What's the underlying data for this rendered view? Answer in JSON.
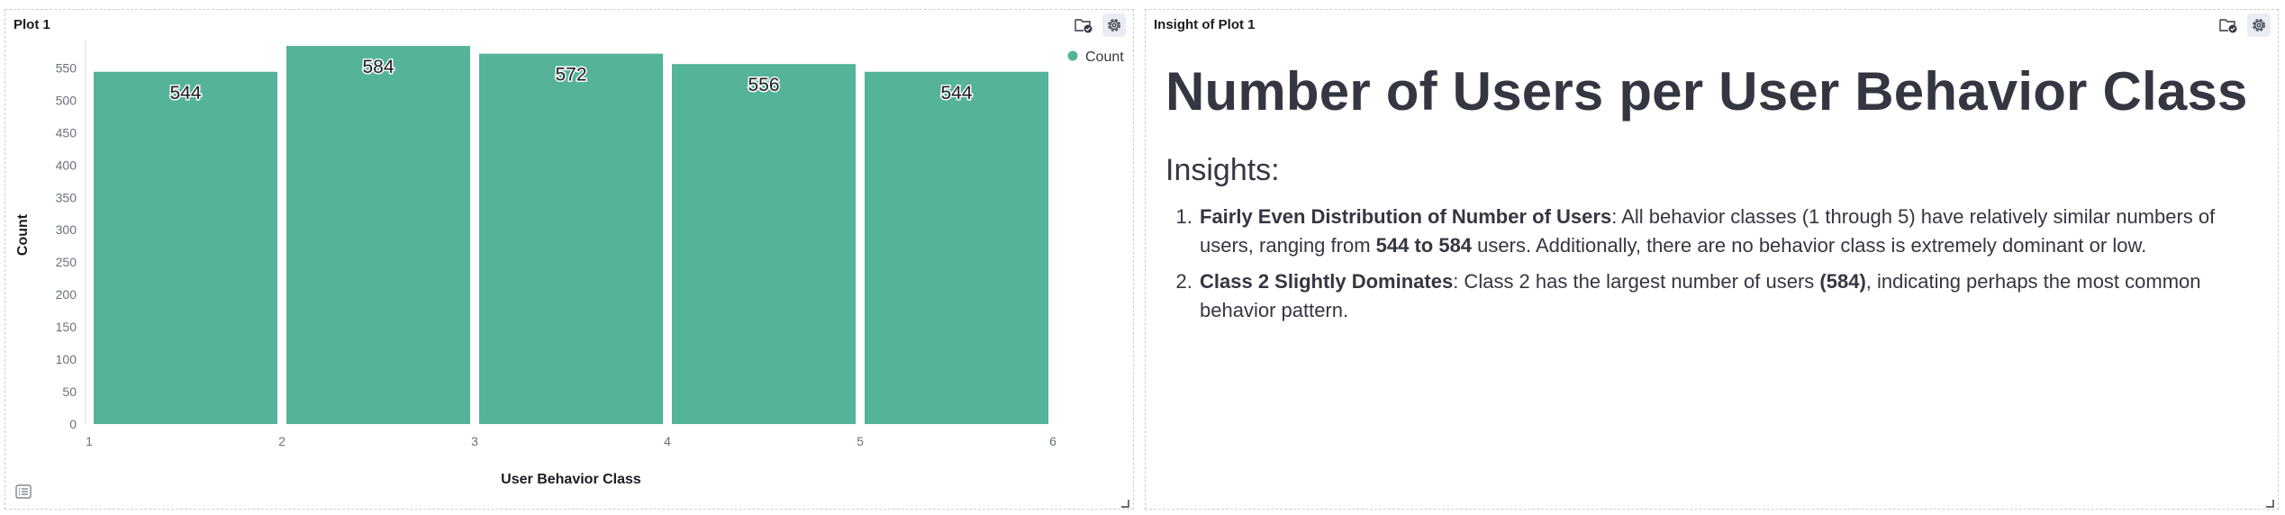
{
  "plot_panel": {
    "title": "Plot 1",
    "icons": [
      "folder-check-icon",
      "gear-icon",
      "list-icon",
      "resize-icon"
    ]
  },
  "insight_panel": {
    "title": "Insight of Plot 1",
    "heading": "Number of Users per User Behavior Class",
    "subheading": "Insights:",
    "items": [
      {
        "lead": "Fairly Even Distribution of Number of Users",
        "text_1": ": All behavior classes (1 through 5) have relatively similar numbers of users, ranging from ",
        "bold_1": "544 to 584",
        "text_2": " users. Additionally, there are no behavior class is extremely dominant or low."
      },
      {
        "lead": "Class 2 Slightly Dominates",
        "text_1": ": Class 2 has the largest number of users ",
        "bold_1": "(584)",
        "text_2": ", indicating perhaps the most common behavior pattern."
      }
    ]
  },
  "chart_data": {
    "type": "bar",
    "bins": [
      [
        1,
        2
      ],
      [
        2,
        3
      ],
      [
        3,
        4
      ],
      [
        4,
        5
      ],
      [
        5,
        6
      ]
    ],
    "values": [
      544,
      584,
      572,
      556,
      544
    ],
    "data_labels": [
      "544",
      "584",
      "572",
      "556",
      "544"
    ],
    "xticks": [
      "1",
      "2",
      "3",
      "4",
      "5",
      "6"
    ],
    "yticks": [
      "0",
      "50",
      "100",
      "150",
      "200",
      "250",
      "300",
      "350",
      "400",
      "450",
      "500",
      "550"
    ],
    "xlim": [
      1,
      6
    ],
    "ylim": [
      0,
      584
    ],
    "xlabel": "User Behavior Class",
    "ylabel": "Count",
    "legend": [
      {
        "name": "Count",
        "color": "#54b399"
      }
    ],
    "legend_position": "top-right",
    "bar_color": "#54b399",
    "grid": false
  }
}
